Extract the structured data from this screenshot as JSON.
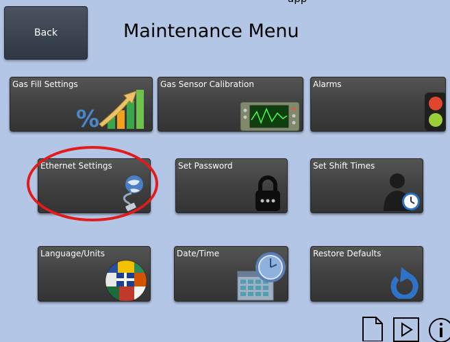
{
  "header": {
    "cut_text": "app",
    "back_label": "Back",
    "title": "Maintenance Menu"
  },
  "tiles": [
    {
      "label": "Gas Fill Settings",
      "icon": "percent-growth-chart-icon"
    },
    {
      "label": "Gas Sensor Calibration",
      "icon": "oscilloscope-icon"
    },
    {
      "label": "Alarms",
      "icon": "traffic-light-icon"
    },
    {
      "label": "Ethernet Settings",
      "icon": "globe-network-cable-icon"
    },
    {
      "label": "Set Password",
      "icon": "padlock-icon"
    },
    {
      "label": "Set Shift Times",
      "icon": "person-clock-icon"
    },
    {
      "label": "Language/Units",
      "icon": "flags-globe-icon"
    },
    {
      "label": "Date/Time",
      "icon": "calendar-clock-icon"
    },
    {
      "label": "Restore Defaults",
      "icon": "restore-arrow-icon"
    }
  ],
  "bottom_icons": [
    "document-icon",
    "play-icon",
    "info-icon"
  ],
  "colors": {
    "background": "#b3c6e5",
    "tile": "#444444",
    "highlight": "#e31b1b"
  }
}
